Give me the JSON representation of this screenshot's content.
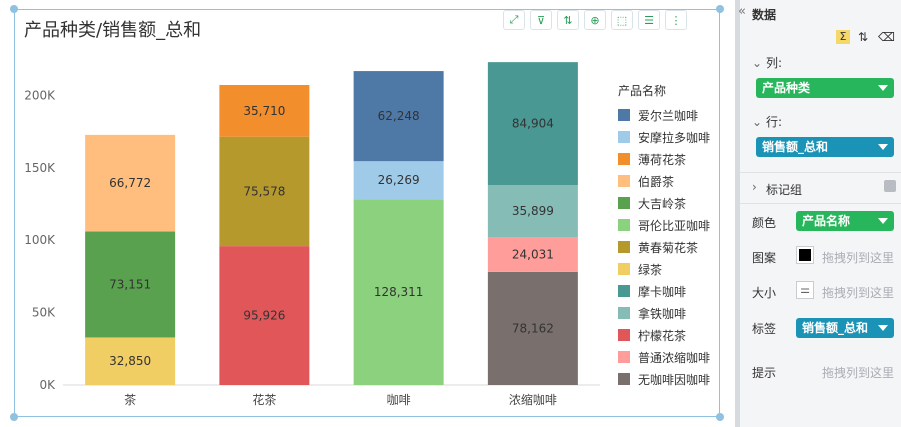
{
  "chart": {
    "title": "产品种类/销售额_总和"
  },
  "chart_data": {
    "type": "bar",
    "stacked": true,
    "categories": [
      "茶",
      "花茶",
      "咖啡",
      "浓缩咖啡"
    ],
    "ylim": [
      0,
      230000
    ],
    "yticks": [
      {
        "value": 0,
        "label": "0K"
      },
      {
        "value": 50000,
        "label": "50K"
      },
      {
        "value": 100000,
        "label": "100K"
      },
      {
        "value": 150000,
        "label": "150K"
      },
      {
        "value": 200000,
        "label": "200K"
      }
    ],
    "legend_title": "产品名称",
    "legend_position": "right",
    "grid": false,
    "series": [
      {
        "name": "爱尔兰咖啡",
        "color": "#4e79a7",
        "values": [
          null,
          null,
          62248,
          null
        ]
      },
      {
        "name": "安摩拉多咖啡",
        "color": "#a0cbe8",
        "values": [
          null,
          null,
          26269,
          null
        ]
      },
      {
        "name": "薄荷花茶",
        "color": "#f28e2b",
        "values": [
          null,
          35710,
          null,
          null
        ]
      },
      {
        "name": "伯爵茶",
        "color": "#ffbe7d",
        "values": [
          66772,
          null,
          null,
          null
        ]
      },
      {
        "name": "大吉岭茶",
        "color": "#59a14f",
        "values": [
          73151,
          null,
          null,
          null
        ]
      },
      {
        "name": "哥伦比亚咖啡",
        "color": "#8cd17d",
        "values": [
          null,
          null,
          128311,
          null
        ]
      },
      {
        "name": "黄春菊花茶",
        "color": "#b6992d",
        "values": [
          null,
          75578,
          null,
          null
        ]
      },
      {
        "name": "绿茶",
        "color": "#f1ce63",
        "values": [
          32850,
          null,
          null,
          null
        ]
      },
      {
        "name": "摩卡咖啡",
        "color": "#499894",
        "values": [
          null,
          null,
          null,
          84904
        ]
      },
      {
        "name": "拿铁咖啡",
        "color": "#86bcb6",
        "values": [
          null,
          null,
          null,
          35899
        ]
      },
      {
        "name": "柠檬花茶",
        "color": "#e15759",
        "values": [
          null,
          95926,
          null,
          null
        ]
      },
      {
        "name": "普通浓缩咖啡",
        "color": "#ff9d9a",
        "values": [
          null,
          null,
          null,
          24031
        ]
      },
      {
        "name": "无咖啡因咖啡",
        "color": "#79706e",
        "values": [
          null,
          null,
          null,
          78162
        ]
      }
    ],
    "stack_order": [
      [
        "绿茶",
        "大吉岭茶",
        "伯爵茶"
      ],
      [
        "柠檬花茶",
        "黄春菊花茶",
        "薄荷花茶"
      ],
      [
        "哥伦比亚咖啡",
        "安摩拉多咖啡",
        "爱尔兰咖啡"
      ],
      [
        "无咖啡因咖啡",
        "普通浓缩咖啡",
        "拿铁咖啡",
        "摩卡咖啡"
      ]
    ]
  },
  "toolbar": {
    "icons": [
      "fullscreen-icon",
      "filter-icon",
      "sort-icon",
      "zoom-icon",
      "select-icon",
      "list-icon",
      "more-icon"
    ],
    "glyphs": [
      "⤢",
      "⊽",
      "⇅",
      "⊕",
      "⬚",
      "☰",
      "⋮"
    ]
  },
  "side": {
    "header": "数据",
    "collapse_glyph": "«",
    "icon_glyphs": [
      "Σ",
      "⇅",
      "⌫"
    ],
    "columns_label": "列:",
    "columns_value": "产品种类",
    "rows_label": "行:",
    "rows_value": "销售额_总和",
    "marks_label": "标记组",
    "color_label": "颜色",
    "color_value": "产品名称",
    "pattern_label": "图案",
    "pattern_placeholder": "拖拽列到这里",
    "size_label": "大小",
    "size_placeholder": "拖拽列到这里",
    "label_label": "标签",
    "label_value": "销售额_总和",
    "tooltip_label": "提示",
    "tooltip_placeholder": "拖拽列到这里"
  }
}
